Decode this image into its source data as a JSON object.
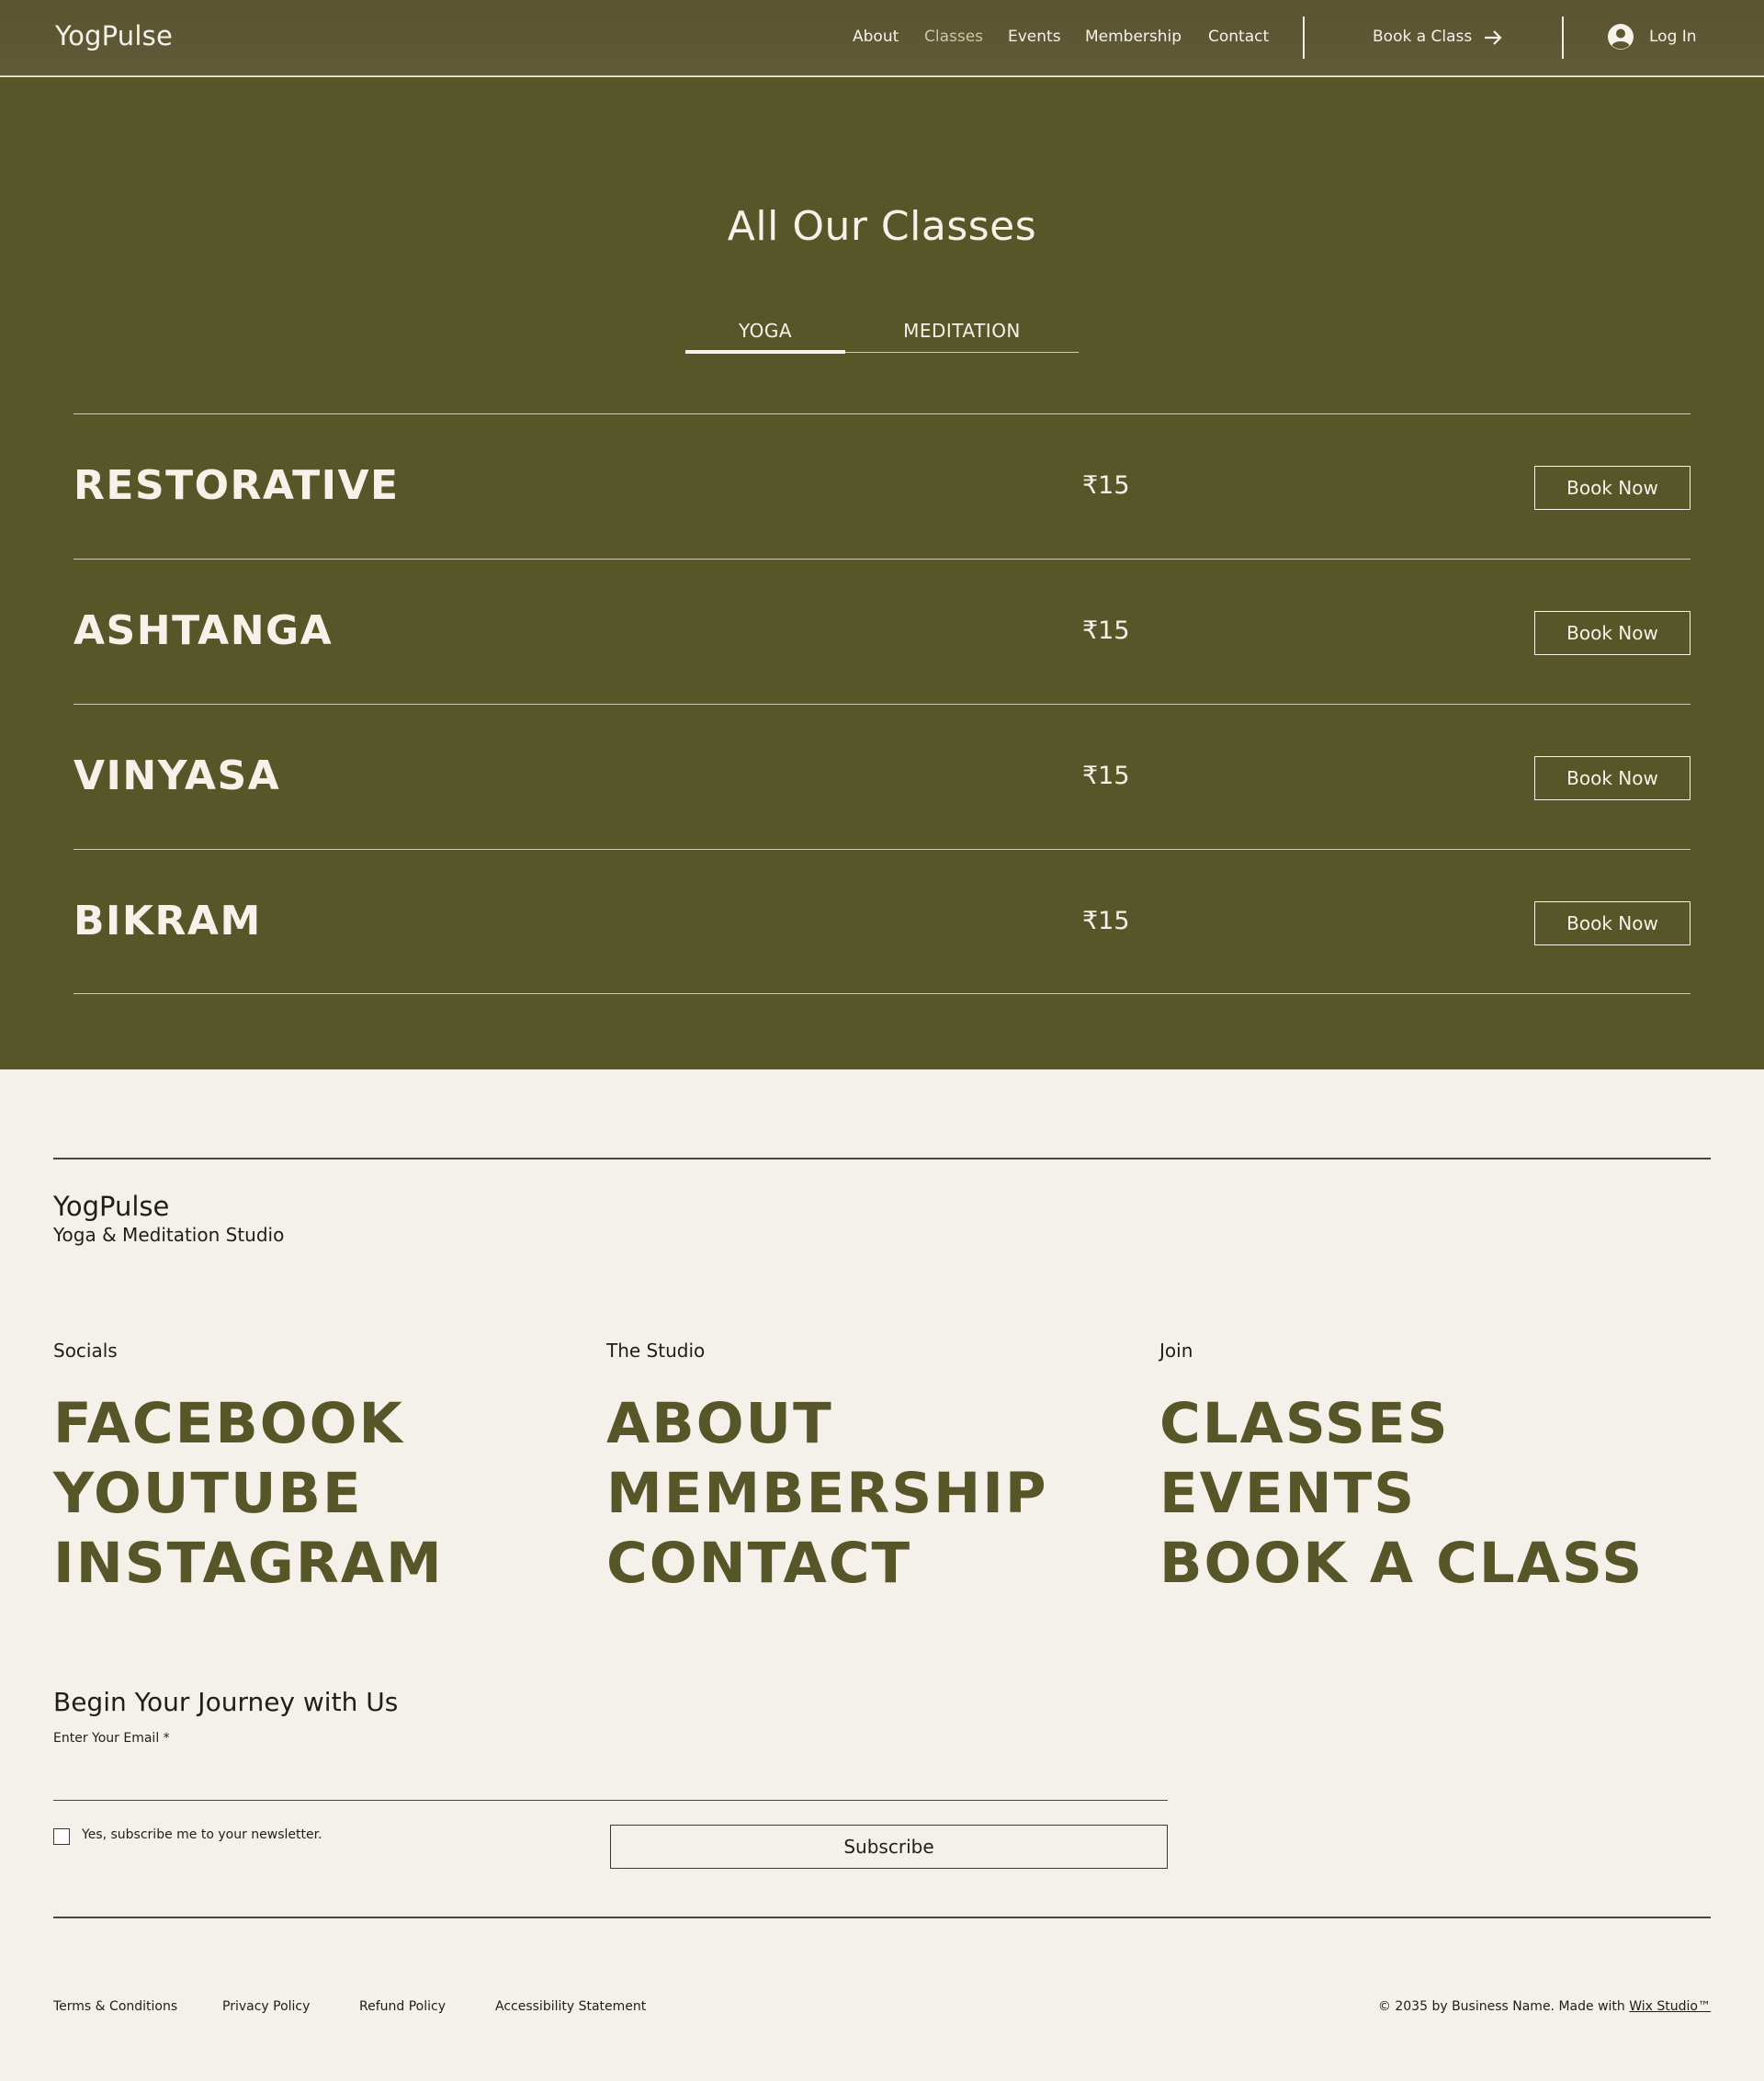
{
  "header": {
    "logo": "YogPulse",
    "nav": [
      "About",
      "Classes",
      "Events",
      "Membership",
      "Contact"
    ],
    "active_nav": "Classes",
    "book_class": "Book a Class",
    "login": "Log In",
    "icons": {
      "arrow": "arrow-right-icon",
      "user": "user-avatar-icon"
    }
  },
  "classes_section": {
    "title": "All Our Classes",
    "tabs": [
      "YOGA",
      "MEDITATION"
    ],
    "active_tab": "YOGA",
    "items": [
      {
        "name": "RESTORATIVE",
        "price": "₹15",
        "button": "Book Now"
      },
      {
        "name": "ASHTANGA",
        "price": "₹15",
        "button": "Book Now"
      },
      {
        "name": "VINYASA",
        "price": "₹15",
        "button": "Book Now"
      },
      {
        "name": "BIKRAM",
        "price": "₹15",
        "button": "Book Now"
      }
    ]
  },
  "footer": {
    "logo": "YogPulse",
    "tagline": "Yoga & Meditation Studio",
    "columns": [
      {
        "heading": "Socials",
        "links": [
          "FACEBOOK",
          "YOUTUBE",
          "INSTAGRAM"
        ]
      },
      {
        "heading": "The Studio",
        "links": [
          "ABOUT",
          "MEMBERSHIP",
          "CONTACT"
        ]
      },
      {
        "heading": "Join",
        "links": [
          "CLASSES",
          "EVENTS",
          "BOOK A CLASS"
        ]
      }
    ],
    "newsletter": {
      "title": "Begin Your Journey with Us",
      "email_label": "Enter Your Email *",
      "checkbox_label": "Yes, subscribe me to your newsletter.",
      "button": "Subscribe"
    },
    "legal_links": [
      "Terms & Conditions",
      "Privacy Policy",
      "Refund Policy",
      "Accessibility Statement"
    ],
    "copyright_prefix": "© 2035 by Business Name. Made with ",
    "copyright_link": "Wix Studio™"
  },
  "colors": {
    "olive": "#575629",
    "cream": "#f4f0ea",
    "text_light": "#f6f2e9",
    "text_dark": "#1f1f17"
  }
}
